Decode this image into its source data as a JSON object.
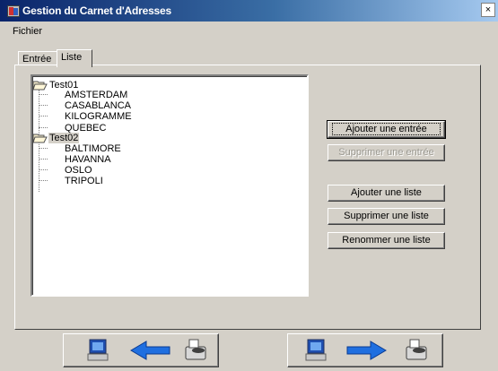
{
  "window": {
    "title": "Gestion du Carnet d'Adresses",
    "close_glyph": "×"
  },
  "menu": {
    "items": [
      "Fichier"
    ]
  },
  "tabs": [
    {
      "label": "Entrée",
      "active": false
    },
    {
      "label": "Liste",
      "active": true
    }
  ],
  "tree": {
    "groups": [
      {
        "label": "Test01",
        "selected": false,
        "children": [
          "AMSTERDAM",
          "CASABLANCA",
          "KILOGRAMME",
          "QUEBEC"
        ]
      },
      {
        "label": "Test02",
        "selected": true,
        "children": [
          "BALTIMORE",
          "HAVANNA",
          "OSLO",
          "TRIPOLI"
        ]
      }
    ]
  },
  "buttons": {
    "add_entry": "Ajouter une entrée",
    "delete_entry": "Supprimer une entrée",
    "add_list": "Ajouter une liste",
    "delete_list": "Supprimer une liste",
    "rename_list": "Renommer une liste"
  },
  "nav": {
    "prev_icons": [
      "computer-icon",
      "arrow-left-icon",
      "fax-icon"
    ],
    "next_icons": [
      "computer-icon",
      "arrow-right-icon",
      "fax-icon"
    ]
  },
  "colors": {
    "titlebar_start": "#0a246a",
    "titlebar_end": "#a6caf0",
    "window_bg": "#d4d0c8",
    "arrow_blue": "#1f6fe0"
  }
}
